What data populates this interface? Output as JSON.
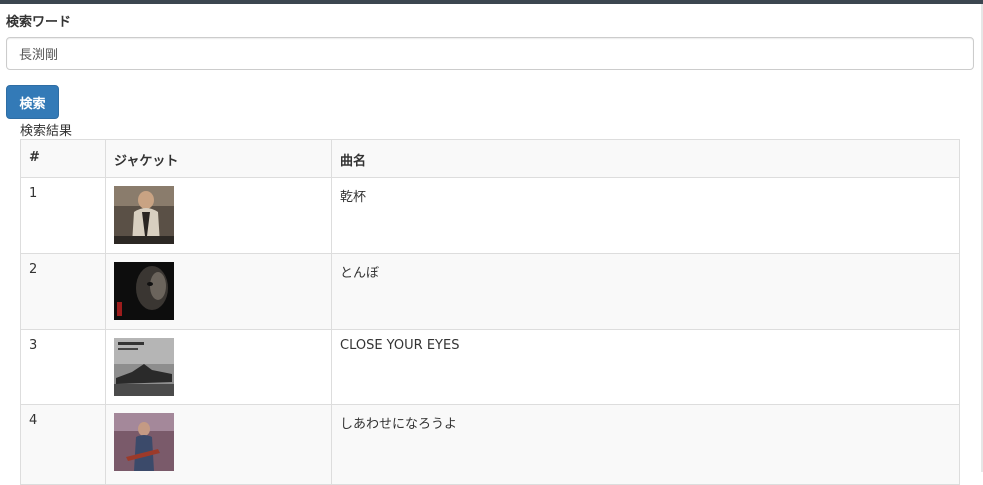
{
  "search": {
    "label": "検索ワード",
    "value": "長渕剛",
    "button_label": "検索"
  },
  "results": {
    "label": "検索結果",
    "columns": [
      "#",
      "ジャケット",
      "曲名"
    ],
    "rows": [
      {
        "num": "1",
        "title": "乾杯"
      },
      {
        "num": "2",
        "title": "とんぼ"
      },
      {
        "num": "3",
        "title": "CLOSE YOUR EYES"
      },
      {
        "num": "4",
        "title": "しあわせになろうよ"
      }
    ]
  }
}
